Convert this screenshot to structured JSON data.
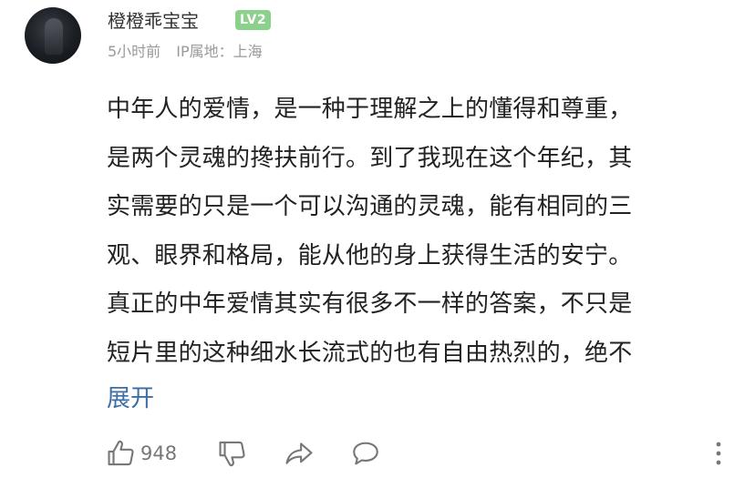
{
  "user": {
    "name": "橙橙乖宝宝",
    "level": "LV2",
    "time": "5小时前",
    "ip_location": "IP属地：上海"
  },
  "comment": {
    "lines": [
      "中年人的爱情，是一种于理解之上的懂得和尊重，",
      "是两个灵魂的搀扶前行。到了我现在这个年纪，其",
      "实需要的只是一个可以沟通的灵魂，能有相同的三",
      "观、眼界和格局，能从他的身上获得生活的安宁。",
      "真正的中年爱情其实有很多不一样的答案，不只是",
      "短片里的这种细水长流式的也有自由热烈的，绝不"
    ],
    "expand_label": "展开"
  },
  "actions": {
    "like_count": "948",
    "icons": [
      "thumbs-up-icon",
      "thumbs-down-icon",
      "share-icon",
      "reply-icon",
      "more-icon"
    ]
  },
  "colors": {
    "link": "#3a6ea6",
    "meta": "#999999",
    "level_badge": "#8bd18b"
  }
}
